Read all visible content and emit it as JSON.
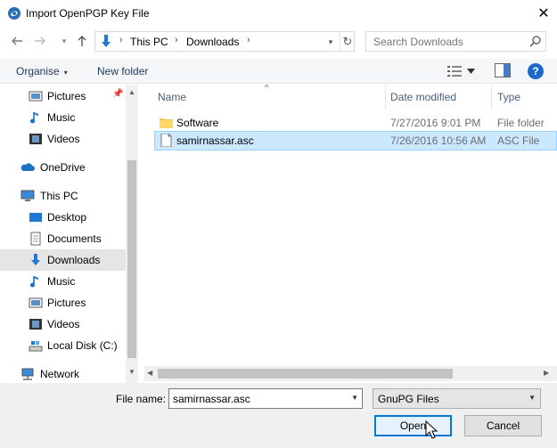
{
  "window": {
    "title": "Import OpenPGP Key File",
    "close_glyph": "✕"
  },
  "address": {
    "crumbs": [
      "This PC",
      "Downloads"
    ],
    "separator": "›",
    "dropdown_glyph": "▾",
    "refresh_glyph": "↻"
  },
  "search": {
    "placeholder": "Search Downloads"
  },
  "toolbar": {
    "organise_label": "Organise",
    "organise_caret": "▾",
    "new_folder_label": "New folder",
    "help_label": "?"
  },
  "nav": {
    "items": [
      {
        "label": "Pictures",
        "icon": "pictures-icon",
        "pinned": true
      },
      {
        "label": "Music",
        "icon": "music-icon"
      },
      {
        "label": "Videos",
        "icon": "videos-icon"
      },
      {
        "label": "OneDrive",
        "icon": "onedrive-icon"
      },
      {
        "label": "This PC",
        "icon": "this-pc-icon"
      },
      {
        "label": "Desktop",
        "icon": "desktop-icon"
      },
      {
        "label": "Documents",
        "icon": "documents-icon"
      },
      {
        "label": "Downloads",
        "icon": "downloads-icon",
        "selected": true
      },
      {
        "label": "Music",
        "icon": "music-icon"
      },
      {
        "label": "Pictures",
        "icon": "pictures-icon"
      },
      {
        "label": "Videos",
        "icon": "videos-icon"
      },
      {
        "label": "Local Disk (C:)",
        "icon": "local-disk-icon"
      },
      {
        "label": "Network",
        "icon": "network-icon"
      }
    ]
  },
  "files": {
    "columns": [
      "Name",
      "Date modified",
      "Type"
    ],
    "rows": [
      {
        "name": "Software",
        "date": "7/27/2016 9:01 PM",
        "type": "File folder",
        "icon": "folder-icon"
      },
      {
        "name": "samirnassar.asc",
        "date": "7/26/2016 10:56 AM",
        "type": "ASC File",
        "icon": "file-icon",
        "selected": true
      }
    ]
  },
  "footer": {
    "file_name_label": "File name:",
    "file_name_value": "samirnassar.asc",
    "filter_value": "GnuPG Files",
    "open_label": "Open",
    "cancel_label": "Cancel"
  },
  "colors": {
    "selection_bg": "#cce8ff",
    "selection_border": "#99d1ff",
    "accent": "#0078d7",
    "nav_selected": "#e5e5e5"
  }
}
